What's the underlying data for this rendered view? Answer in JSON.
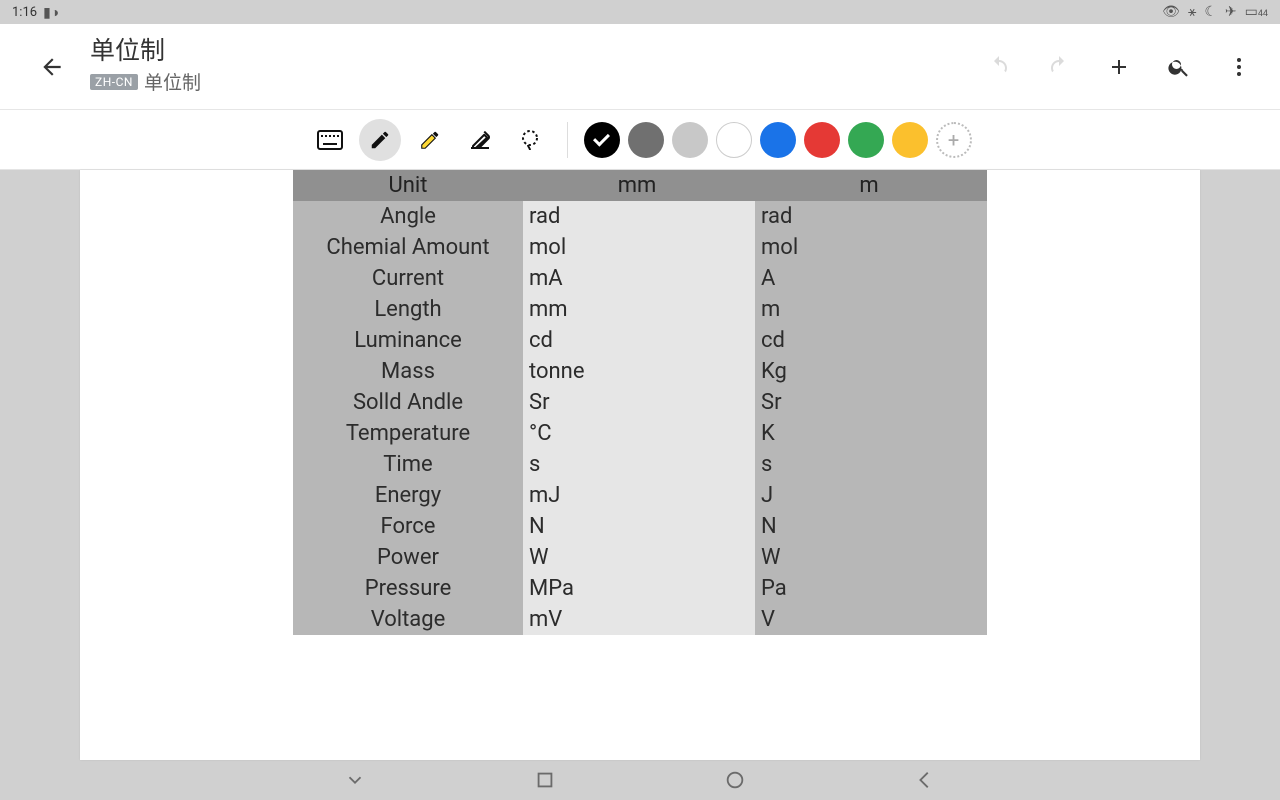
{
  "status": {
    "time": "1:16",
    "battery": "44"
  },
  "header": {
    "title": "单位制",
    "lang_badge": "ZH-CN",
    "subtitle": "单位制"
  },
  "toolbar": {
    "colors": {
      "black": "#000000",
      "gray": "#707070",
      "lightgray": "#c8c8c8",
      "white": "#ffffff",
      "blue": "#1a73e8",
      "red": "#e53935",
      "green": "#34a853",
      "yellow": "#fbc02d"
    },
    "selected_color": "black"
  },
  "table": {
    "headers": [
      "Unit",
      "mm",
      "m"
    ],
    "rows": [
      {
        "name": "Angle",
        "mm": "rad",
        "m": "rad"
      },
      {
        "name": "Chemial Amount",
        "mm": "mol",
        "m": "mol"
      },
      {
        "name": "Current",
        "mm": "mA",
        "m": "A"
      },
      {
        "name": "Length",
        "mm": "mm",
        "m": "m"
      },
      {
        "name": "Luminance",
        "mm": "cd",
        "m": "cd"
      },
      {
        "name": "Mass",
        "mm": "tonne",
        "m": "Kg"
      },
      {
        "name": "Solld Andle",
        "mm": "Sr",
        "m": "Sr"
      },
      {
        "name": "Temperature",
        "mm": "°C",
        "m": "K"
      },
      {
        "name": "Time",
        "mm": "s",
        "m": "s"
      },
      {
        "name": "Energy",
        "mm": "mJ",
        "m": "J"
      },
      {
        "name": "Force",
        "mm": "N",
        "m": "N"
      },
      {
        "name": "Power",
        "mm": "W",
        "m": "W"
      },
      {
        "name": "Pressure",
        "mm": "MPa",
        "m": "Pa"
      },
      {
        "name": "Voltage",
        "mm": "mV",
        "m": "V"
      }
    ]
  }
}
